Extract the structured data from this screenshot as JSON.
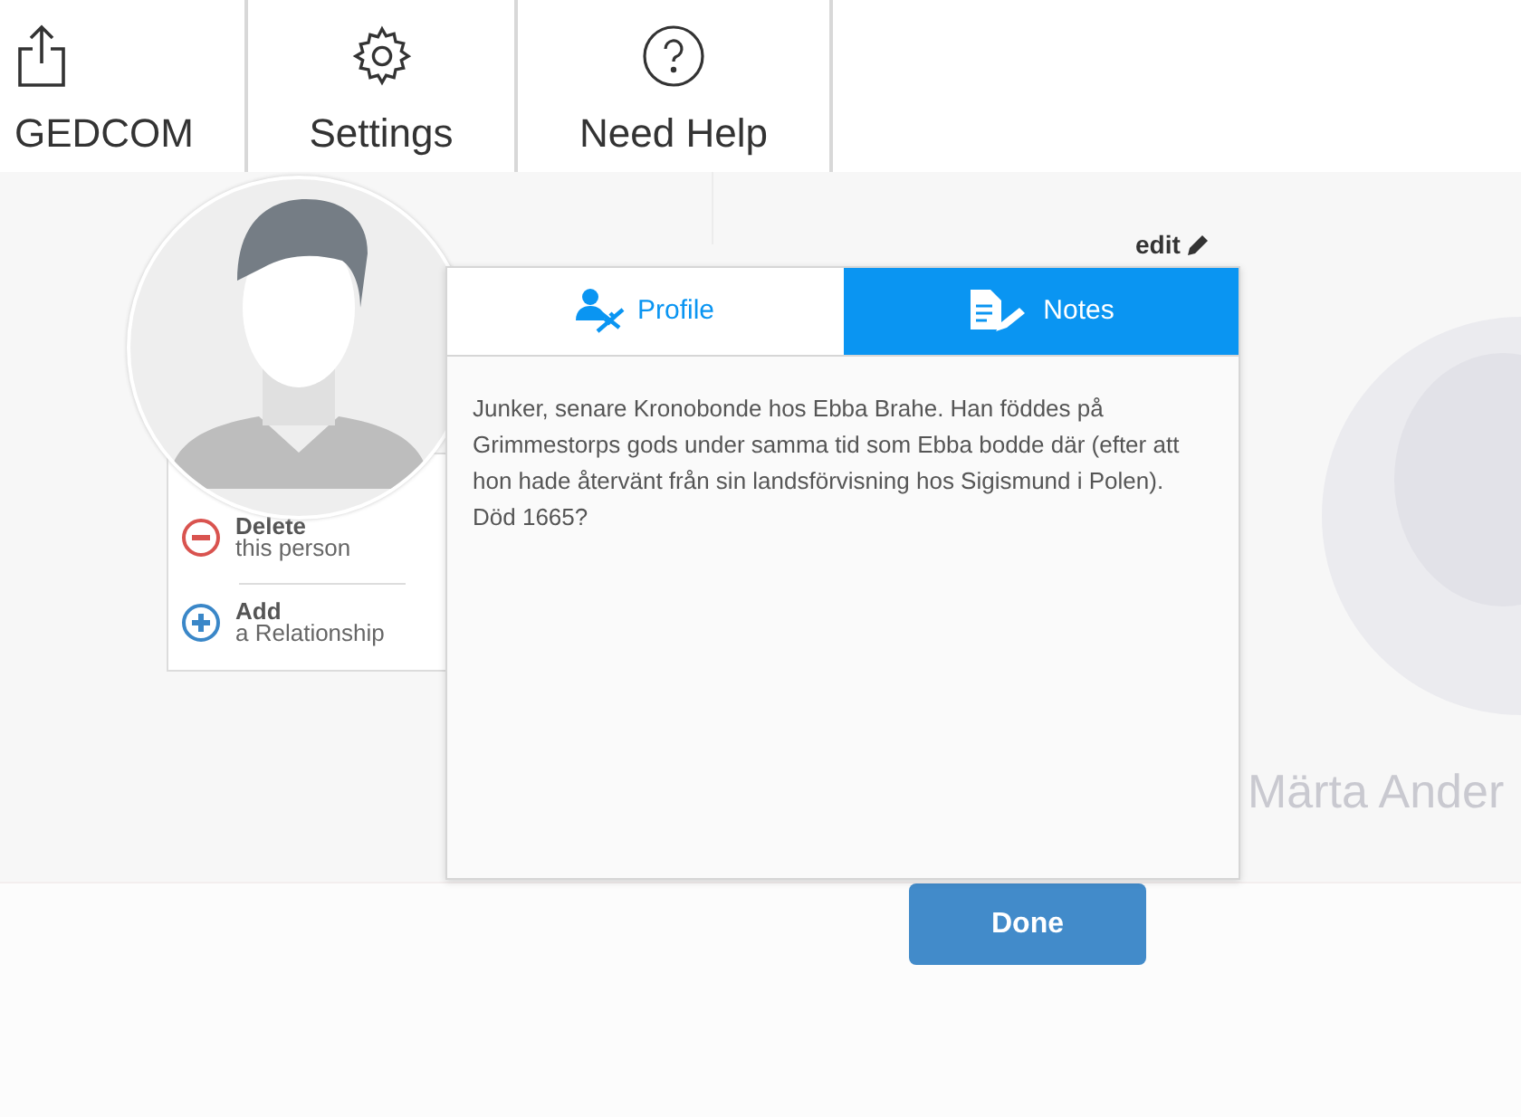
{
  "toolbar": [
    {
      "kind": "share",
      "label": "GEDCOM"
    },
    {
      "kind": "settings",
      "label": "Settings"
    },
    {
      "kind": "help",
      "label": "Need Help"
    }
  ],
  "background_person": {
    "name": "Märta Ander"
  },
  "person_actions": [
    {
      "kind": "delete",
      "title": "Delete",
      "subtitle": "this person"
    },
    {
      "kind": "add",
      "title": "Add",
      "subtitle": "a Relationship"
    }
  ],
  "edit_link": "edit",
  "tabs": [
    {
      "kind": "profile",
      "label": "Profile",
      "selected": false
    },
    {
      "kind": "notes",
      "label": "Notes",
      "selected": true
    }
  ],
  "notes_text": "Junker, senare Kronobonde hos Ebba Brahe. Han föddes på Grimmestorps gods under samma tid som Ebba bodde där (efter att hon hade återvänt från sin landsförvisning hos Sigismund i Polen). Död 1665?",
  "done_button": "Done"
}
